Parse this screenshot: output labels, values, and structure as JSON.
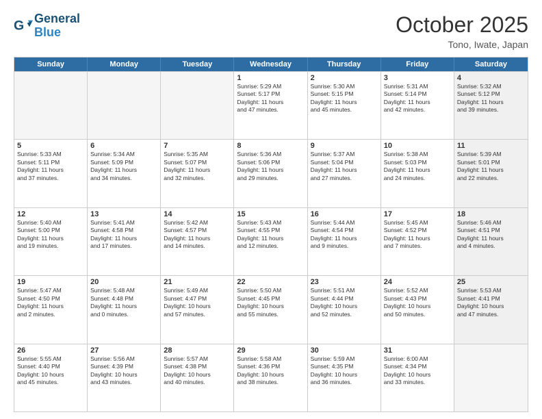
{
  "header": {
    "logo_general": "General",
    "logo_blue": "Blue",
    "month_title": "October 2025",
    "location": "Tono, Iwate, Japan"
  },
  "weekdays": [
    "Sunday",
    "Monday",
    "Tuesday",
    "Wednesday",
    "Thursday",
    "Friday",
    "Saturday"
  ],
  "rows": [
    [
      {
        "day": "",
        "text": "",
        "empty": true
      },
      {
        "day": "",
        "text": "",
        "empty": true
      },
      {
        "day": "",
        "text": "",
        "empty": true
      },
      {
        "day": "1",
        "text": "Sunrise: 5:29 AM\nSunset: 5:17 PM\nDaylight: 11 hours\nand 47 minutes.",
        "empty": false
      },
      {
        "day": "2",
        "text": "Sunrise: 5:30 AM\nSunset: 5:15 PM\nDaylight: 11 hours\nand 45 minutes.",
        "empty": false
      },
      {
        "day": "3",
        "text": "Sunrise: 5:31 AM\nSunset: 5:14 PM\nDaylight: 11 hours\nand 42 minutes.",
        "empty": false
      },
      {
        "day": "4",
        "text": "Sunrise: 5:32 AM\nSunset: 5:12 PM\nDaylight: 11 hours\nand 39 minutes.",
        "empty": false,
        "shade": true
      }
    ],
    [
      {
        "day": "5",
        "text": "Sunrise: 5:33 AM\nSunset: 5:11 PM\nDaylight: 11 hours\nand 37 minutes.",
        "empty": false
      },
      {
        "day": "6",
        "text": "Sunrise: 5:34 AM\nSunset: 5:09 PM\nDaylight: 11 hours\nand 34 minutes.",
        "empty": false
      },
      {
        "day": "7",
        "text": "Sunrise: 5:35 AM\nSunset: 5:07 PM\nDaylight: 11 hours\nand 32 minutes.",
        "empty": false
      },
      {
        "day": "8",
        "text": "Sunrise: 5:36 AM\nSunset: 5:06 PM\nDaylight: 11 hours\nand 29 minutes.",
        "empty": false
      },
      {
        "day": "9",
        "text": "Sunrise: 5:37 AM\nSunset: 5:04 PM\nDaylight: 11 hours\nand 27 minutes.",
        "empty": false
      },
      {
        "day": "10",
        "text": "Sunrise: 5:38 AM\nSunset: 5:03 PM\nDaylight: 11 hours\nand 24 minutes.",
        "empty": false
      },
      {
        "day": "11",
        "text": "Sunrise: 5:39 AM\nSunset: 5:01 PM\nDaylight: 11 hours\nand 22 minutes.",
        "empty": false,
        "shade": true
      }
    ],
    [
      {
        "day": "12",
        "text": "Sunrise: 5:40 AM\nSunset: 5:00 PM\nDaylight: 11 hours\nand 19 minutes.",
        "empty": false
      },
      {
        "day": "13",
        "text": "Sunrise: 5:41 AM\nSunset: 4:58 PM\nDaylight: 11 hours\nand 17 minutes.",
        "empty": false
      },
      {
        "day": "14",
        "text": "Sunrise: 5:42 AM\nSunset: 4:57 PM\nDaylight: 11 hours\nand 14 minutes.",
        "empty": false
      },
      {
        "day": "15",
        "text": "Sunrise: 5:43 AM\nSunset: 4:55 PM\nDaylight: 11 hours\nand 12 minutes.",
        "empty": false
      },
      {
        "day": "16",
        "text": "Sunrise: 5:44 AM\nSunset: 4:54 PM\nDaylight: 11 hours\nand 9 minutes.",
        "empty": false
      },
      {
        "day": "17",
        "text": "Sunrise: 5:45 AM\nSunset: 4:52 PM\nDaylight: 11 hours\nand 7 minutes.",
        "empty": false
      },
      {
        "day": "18",
        "text": "Sunrise: 5:46 AM\nSunset: 4:51 PM\nDaylight: 11 hours\nand 4 minutes.",
        "empty": false,
        "shade": true
      }
    ],
    [
      {
        "day": "19",
        "text": "Sunrise: 5:47 AM\nSunset: 4:50 PM\nDaylight: 11 hours\nand 2 minutes.",
        "empty": false
      },
      {
        "day": "20",
        "text": "Sunrise: 5:48 AM\nSunset: 4:48 PM\nDaylight: 11 hours\nand 0 minutes.",
        "empty": false
      },
      {
        "day": "21",
        "text": "Sunrise: 5:49 AM\nSunset: 4:47 PM\nDaylight: 10 hours\nand 57 minutes.",
        "empty": false
      },
      {
        "day": "22",
        "text": "Sunrise: 5:50 AM\nSunset: 4:45 PM\nDaylight: 10 hours\nand 55 minutes.",
        "empty": false
      },
      {
        "day": "23",
        "text": "Sunrise: 5:51 AM\nSunset: 4:44 PM\nDaylight: 10 hours\nand 52 minutes.",
        "empty": false
      },
      {
        "day": "24",
        "text": "Sunrise: 5:52 AM\nSunset: 4:43 PM\nDaylight: 10 hours\nand 50 minutes.",
        "empty": false
      },
      {
        "day": "25",
        "text": "Sunrise: 5:53 AM\nSunset: 4:41 PM\nDaylight: 10 hours\nand 47 minutes.",
        "empty": false,
        "shade": true
      }
    ],
    [
      {
        "day": "26",
        "text": "Sunrise: 5:55 AM\nSunset: 4:40 PM\nDaylight: 10 hours\nand 45 minutes.",
        "empty": false
      },
      {
        "day": "27",
        "text": "Sunrise: 5:56 AM\nSunset: 4:39 PM\nDaylight: 10 hours\nand 43 minutes.",
        "empty": false
      },
      {
        "day": "28",
        "text": "Sunrise: 5:57 AM\nSunset: 4:38 PM\nDaylight: 10 hours\nand 40 minutes.",
        "empty": false
      },
      {
        "day": "29",
        "text": "Sunrise: 5:58 AM\nSunset: 4:36 PM\nDaylight: 10 hours\nand 38 minutes.",
        "empty": false
      },
      {
        "day": "30",
        "text": "Sunrise: 5:59 AM\nSunset: 4:35 PM\nDaylight: 10 hours\nand 36 minutes.",
        "empty": false
      },
      {
        "day": "31",
        "text": "Sunrise: 6:00 AM\nSunset: 4:34 PM\nDaylight: 10 hours\nand 33 minutes.",
        "empty": false
      },
      {
        "day": "",
        "text": "",
        "empty": true,
        "shade": true
      }
    ]
  ]
}
